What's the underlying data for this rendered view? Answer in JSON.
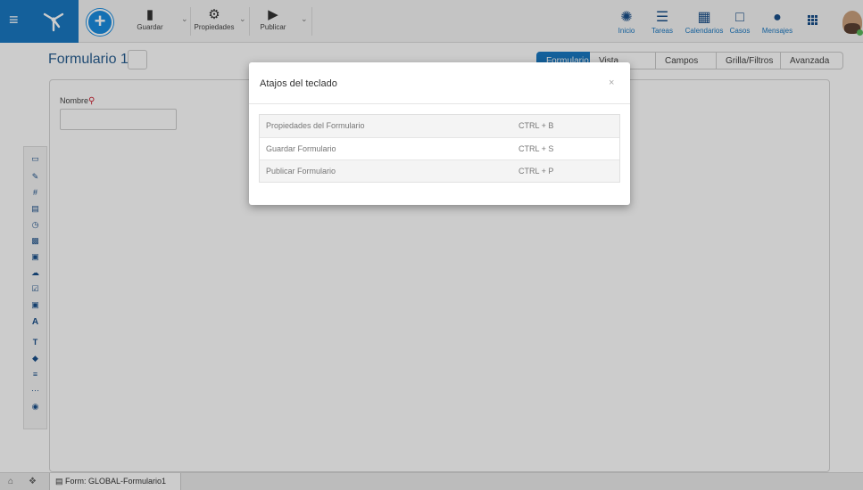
{
  "toolbar": {
    "save_label": "Guardar",
    "properties_label": "Propiedades",
    "publish_label": "Publicar",
    "add_icon": "plus-icon"
  },
  "nav": {
    "inicio": "Inicio",
    "tareas": "Tareas",
    "calendarios": "Calendarios",
    "casos": "Casos",
    "mensajes": "Mensajes"
  },
  "form": {
    "title": "Formulario 1",
    "field_label": "Nombre"
  },
  "tabs": [
    "Formulario",
    "Vista Previa",
    "Campos",
    "Grilla/Filtros",
    "Avanzada"
  ],
  "statusbar": {
    "doc_tab": "Form: GLOBAL-Formulario1"
  },
  "modal": {
    "title": "Atajos del teclado",
    "close": "×",
    "rows": [
      {
        "action": "Propiedades del Formulario",
        "keys": "CTRL + B"
      },
      {
        "action": "Guardar Formulario",
        "keys": "CTRL + S"
      },
      {
        "action": "Publicar Formulario",
        "keys": "CTRL + P"
      }
    ]
  },
  "colors": {
    "brand": "#1a78c2",
    "accent": "#1a8de0",
    "active_tab": "#1a78c2"
  }
}
